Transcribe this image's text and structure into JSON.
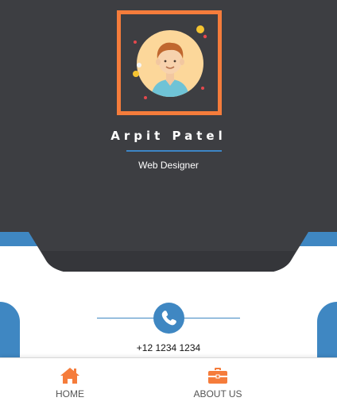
{
  "profile": {
    "name": "Arpit Patel",
    "role": "Web Designer",
    "avatar_icon": "user-avatar-illustration"
  },
  "contact": {
    "phone_icon": "phone-icon",
    "phone": "+12 1234 1234"
  },
  "nav": {
    "home_label": "HOME",
    "home_icon": "home-icon",
    "about_label": "ABOUT US",
    "about_icon": "briefcase-icon"
  },
  "colors": {
    "header_bg": "#3d3e42",
    "accent_orange": "#f57c3b",
    "accent_blue": "#3f87c2",
    "avatar_bg": "#fcd79a"
  }
}
